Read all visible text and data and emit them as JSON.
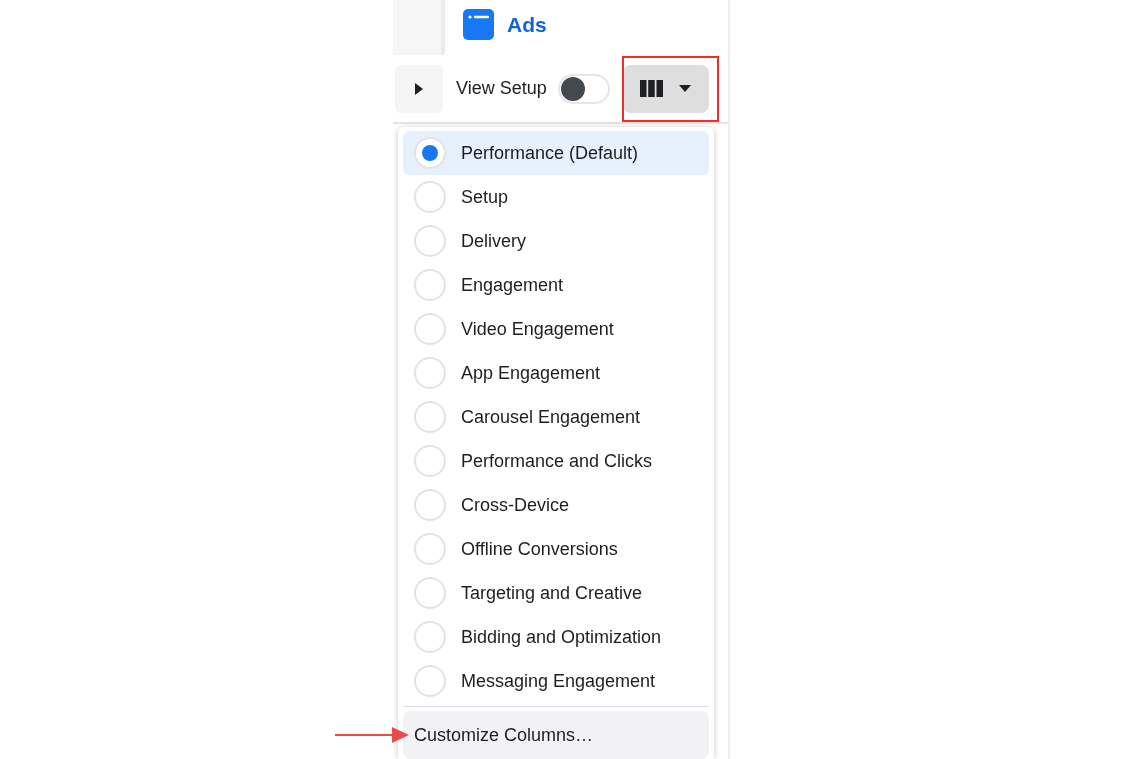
{
  "header": {
    "title": "Ads"
  },
  "toolbar": {
    "view_setup": {
      "label": "View Setup",
      "on": false
    },
    "columns_button": {
      "expanded": true
    }
  },
  "menu": {
    "items": [
      {
        "label": "Performance (Default)",
        "selected": true
      },
      {
        "label": "Setup",
        "selected": false
      },
      {
        "label": "Delivery",
        "selected": false
      },
      {
        "label": "Engagement",
        "selected": false
      },
      {
        "label": "Video Engagement",
        "selected": false
      },
      {
        "label": "App Engagement",
        "selected": false
      },
      {
        "label": "Carousel Engagement",
        "selected": false
      },
      {
        "label": "Performance and Clicks",
        "selected": false
      },
      {
        "label": "Cross-Device",
        "selected": false
      },
      {
        "label": "Offline Conversions",
        "selected": false
      },
      {
        "label": "Targeting and Creative",
        "selected": false
      },
      {
        "label": "Bidding and Optimization",
        "selected": false
      },
      {
        "label": "Messaging Engagement",
        "selected": false
      }
    ],
    "footer_action": "Customize Columns…"
  }
}
